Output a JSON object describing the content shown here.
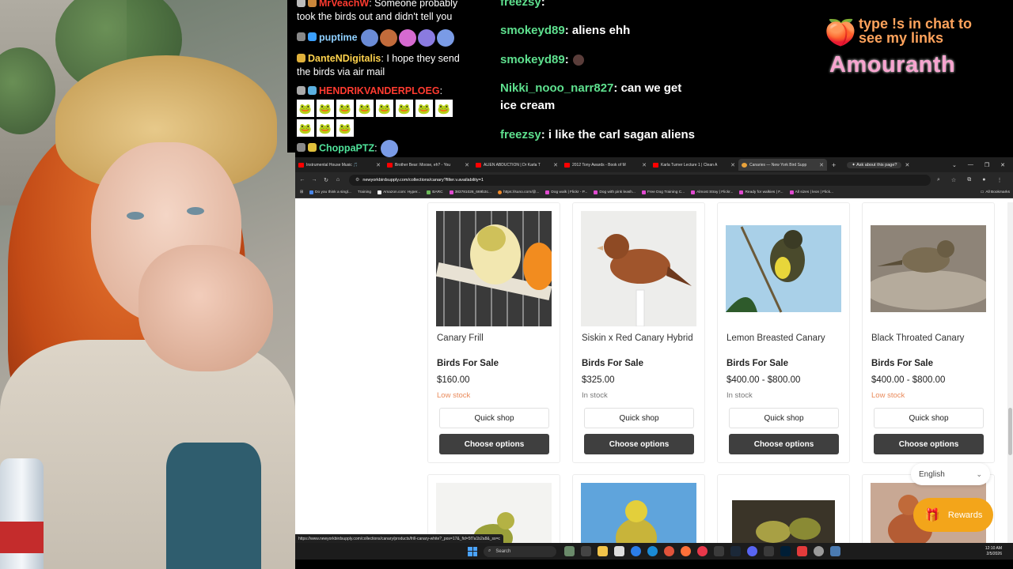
{
  "chat_left": {
    "messages": [
      {
        "user": "MrVeachW",
        "text": ": Someone probably took the birds out and didn't tell you",
        "color": "#ff3b30"
      },
      {
        "user": "puptime",
        "text": "",
        "color": "#8fd0ff"
      },
      {
        "user": "DanteNDigitalis",
        "text": ": I hope they send the birds via air mail",
        "color": "#ffd34d"
      },
      {
        "user": "HENDRIKVANDERPLOEG",
        "text": ":",
        "color": "#ff3b30"
      },
      {
        "user": "ChoppaPTZ",
        "text": ":",
        "color": "#4fe39a"
      }
    ]
  },
  "chat_right": {
    "messages": [
      {
        "user": "freezsy",
        "text": ""
      },
      {
        "user": "smokeyd89",
        "text": " aliens ehh"
      },
      {
        "user": "smokeyd89",
        "text": ""
      },
      {
        "user": "Nikki_nooo_narr827",
        "text": " can we get ice cream"
      },
      {
        "user": "freezsy",
        "text": " i like the carl sagan aliens"
      }
    ]
  },
  "overlay": {
    "links_text": "type !s in chat to see my links",
    "streamer_name": "Amouranth"
  },
  "browser": {
    "tabs": [
      {
        "label": "Instrumental House Music 🎵",
        "active": false
      },
      {
        "label": "Brother Bear: Moose, eh? - You",
        "active": false
      },
      {
        "label": "ALIEN ABDUCTION | Dr Karla T",
        "active": false
      },
      {
        "label": "2012 Tony Awards - Book of M",
        "active": false
      },
      {
        "label": "Karla Turner Lecture 1 | Clean A",
        "active": false
      },
      {
        "label": "Canaries — New York Bird Supp",
        "active": true
      }
    ],
    "ask_label": "Ask about this page?",
    "url": "newyorkbirdsupply.com/collections/canary?filter.v.availability=1",
    "bookmarks": [
      "Do you think a singl...",
      "Training",
      "Amazon.com: Hyper...",
      "BARC",
      "383781026_669b3c...",
      "https://suno.com/@...",
      "Dog walk | Flickr - P...",
      "Dog with pink leash...",
      "Free Dog Training C...",
      "Almost Stray | Flickr...",
      "Ready for walkies | F...",
      "All sizes | leon | Flick...",
      "All Bookmarks"
    ],
    "status_url": "https://www.newyorkbirdsupply.com/collections/canary/products/frill-canary-white?_pos=17&_fid=5f7a1b2a8&_ss=c"
  },
  "products": [
    {
      "title": "Canary Frill",
      "category": "Birds For Sale",
      "price": "$160.00",
      "stock": "Low stock",
      "stock_level": "low",
      "quick_shop": "Quick shop",
      "choose": "Choose options"
    },
    {
      "title": "Siskin x Red Canary Hybrid",
      "category": "Birds For Sale",
      "price": "$325.00",
      "stock": "In stock",
      "stock_level": "in",
      "quick_shop": "Quick shop",
      "choose": "Choose options"
    },
    {
      "title": "Lemon Breasted Canary",
      "category": "Birds For Sale",
      "price": "$400.00 - $800.00",
      "stock": "In stock",
      "stock_level": "in",
      "quick_shop": "Quick shop",
      "choose": "Choose options"
    },
    {
      "title": "Black Throated Canary",
      "category": "Birds For Sale",
      "price": "$400.00 - $800.00",
      "stock": "Low stock",
      "stock_level": "low",
      "quick_shop": "Quick shop",
      "choose": "Choose options"
    }
  ],
  "language": "English",
  "rewards_label": "Rewards",
  "taskbar": {
    "search_placeholder": "Search",
    "time": "12:10 AM",
    "date": "2/5/2026"
  },
  "colors": {
    "chat_green": "#5ee08e",
    "overlay_orange": "#ffa35c",
    "overlay_pink": "#f7a4cf",
    "low_stock": "#e98a5a",
    "rewards": "#f3a51a",
    "button_dark": "#3f3f3f"
  }
}
